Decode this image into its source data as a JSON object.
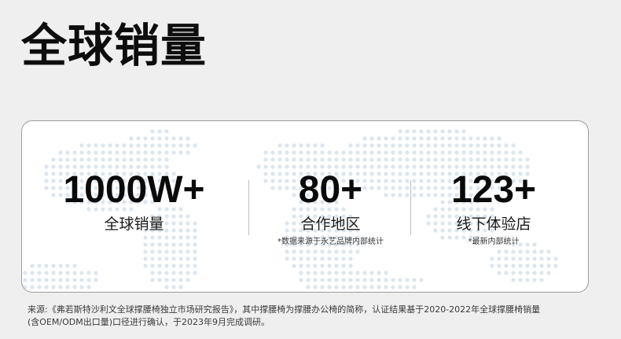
{
  "title": "全球销量",
  "stats": [
    {
      "value": "1000W+",
      "label": "全球销量",
      "note": ""
    },
    {
      "value": "80+",
      "label": "合作地区",
      "note": "*数据来源于永艺品牌内部统计"
    },
    {
      "value": "123+",
      "label": "线下体验店",
      "note": "*最新内部统计"
    }
  ],
  "footnote": {
    "line1": "来源:《弗若斯特沙利文全球撑腰椅独立市场研究报告》，其中撑腰椅为撑腰办公椅的简称，认证结果基于2020-2022年全球撑腰椅销量",
    "line2": "(含OEM/ODM出口量)口径进行确认，于2023年9月完成调研。"
  },
  "colors": {
    "background": "#efefef",
    "card": "#ffffff",
    "card_border": "#9c9c9c",
    "text": "#111111",
    "map_dots": "#dde6ef"
  },
  "background_graphic": "dotted-world-map"
}
